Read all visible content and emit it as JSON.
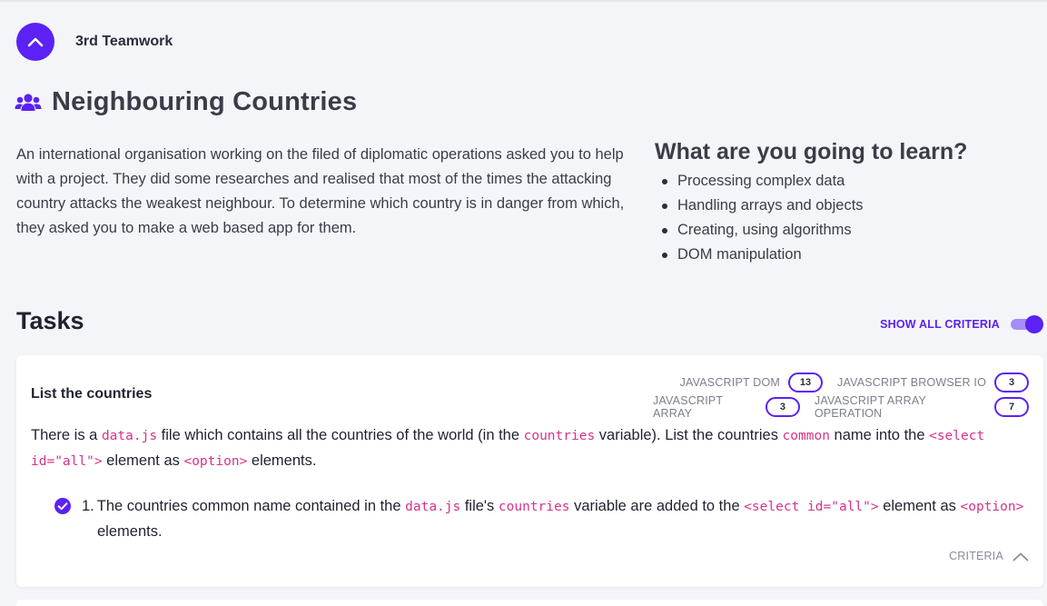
{
  "header": {
    "team_label": "3rd Teamwork"
  },
  "page": {
    "title": "Neighbouring Countries",
    "title_icon": "users-icon"
  },
  "intro": {
    "text": "An international organisation working on the filed of diplomatic operations asked you to help with a project. They did some researches and realised that most of the times the attacking country attacks the weakest neighbour. To determine which country is in danger from which, they asked you to make a web based app for them."
  },
  "learn": {
    "title": "What are you going to learn?",
    "items": [
      "Processing complex data",
      "Handling arrays and objects",
      "Creating, using algorithms",
      "DOM manipulation"
    ]
  },
  "tasks": {
    "title": "Tasks",
    "show_all_criteria_label": "SHOW ALL CRITERIA",
    "show_all_criteria_on": true
  },
  "task": {
    "title": "List the countries",
    "tags": [
      {
        "name": "JAVASCRIPT DOM",
        "count": "13"
      },
      {
        "name": "JAVASCRIPT BROWSER IO",
        "count": "3"
      },
      {
        "name": "JAVASCRIPT ARRAY",
        "count": "3"
      },
      {
        "name": "JAVASCRIPT ARRAY OPERATION",
        "count": "7"
      }
    ],
    "desc": {
      "t1": "There is a ",
      "c1": "data.js",
      "t2": " file which contains all the countries of the world (in the ",
      "c2": "countries",
      "t3": " variable). List the countries ",
      "c3": "common",
      "t4": " name into the ",
      "c4": "<select id=\"all\">",
      "t5": " element as ",
      "c5": "<option>",
      "t6": " elements."
    },
    "criterion": {
      "number": "1.",
      "t1": "The countries common name contained in the ",
      "c1": "data.js",
      "t2": " file's ",
      "c2": "countries",
      "t3": " variable are added to the ",
      "c3": "<select id=\"all\">",
      "t4": " element as ",
      "c4": "<option>",
      "t5": " elements."
    },
    "criteria_footer_label": "CRITERIA"
  },
  "colors": {
    "accent": "#5b21f5",
    "code": "#d6338a",
    "background": "#f4f5f8"
  }
}
